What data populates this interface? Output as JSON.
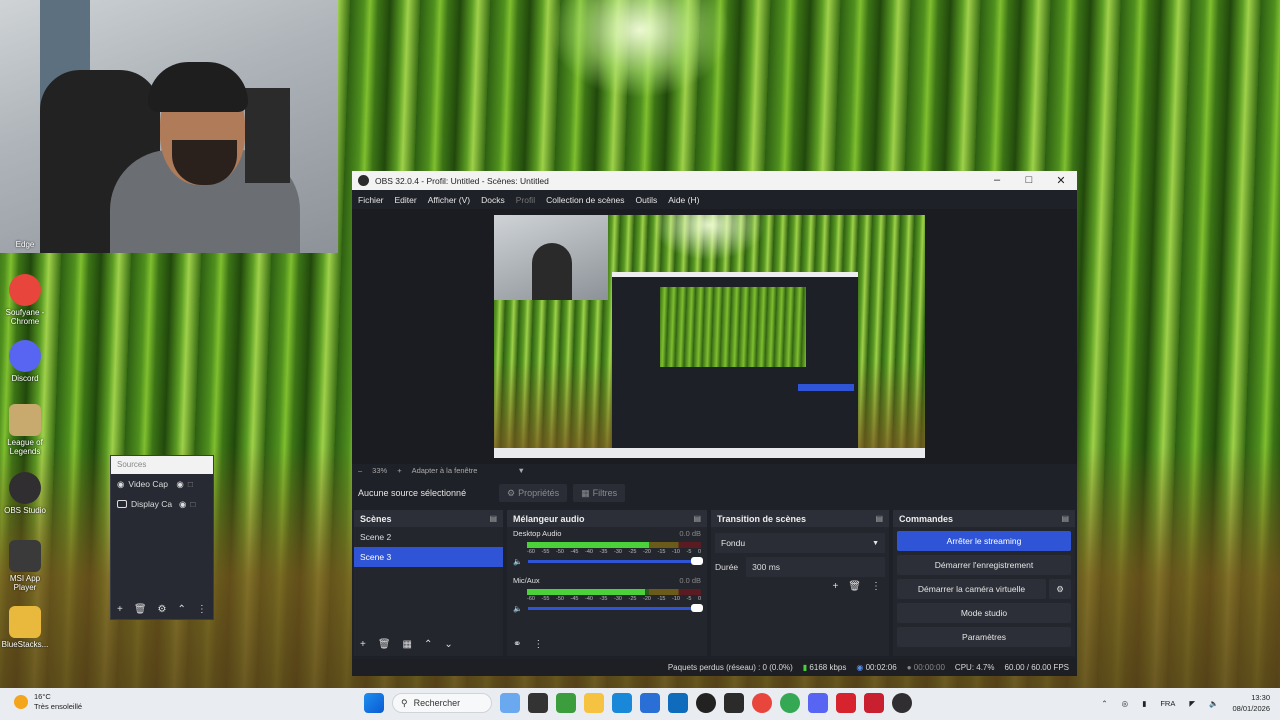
{
  "desktop": {
    "icons": [
      {
        "label": "Edge",
        "color": "#2a7bd6",
        "icon": "edge-icon"
      },
      {
        "label": "Soufyane - Chrome",
        "color": "#e8453c",
        "icon": "chrome-icon"
      },
      {
        "label": "Discord",
        "color": "#5865f2",
        "icon": "discord-icon"
      },
      {
        "label": "League of Legends",
        "color": "#c8aa6e",
        "icon": "league-icon"
      },
      {
        "label": "OBS Studio",
        "color": "#302e31",
        "icon": "obs-icon"
      },
      {
        "label": "MSI App Player",
        "color": "#3a3a3a",
        "icon": "msi-icon"
      },
      {
        "label": "BlueStacks...",
        "color": "#e8b93c",
        "icon": "folder-icon"
      }
    ]
  },
  "sources_dock": {
    "title": "Sources",
    "items": [
      "Video Cap",
      "Display Ca"
    ]
  },
  "obs": {
    "title": "OBS 32.0.4 - Profil: Untitled - Scènes: Untitled",
    "menu": [
      "Fichier",
      "Editer",
      "Afficher (V)",
      "Docks",
      "Profil",
      "Collection de scènes",
      "Outils",
      "Aide (H)"
    ],
    "zoom": "33%",
    "fit_label": "Adapter à la fenêtre",
    "no_source": "Aucune source sélectionné",
    "properties": "Propriétés",
    "filters": "Filtres",
    "scenes_title": "Scènes",
    "scenes": [
      "Scene 2",
      "Scene 3"
    ],
    "selected_scene": "Scene 3",
    "mixer_title": "Mélangeur audio",
    "channels": [
      {
        "name": "Desktop Audio",
        "db": "0.0 dB",
        "level": 0.7
      },
      {
        "name": "Mic/Aux",
        "db": "0.0 dB",
        "level": 0.68
      }
    ],
    "meter_ticks": [
      "-60",
      "-55",
      "-50",
      "-45",
      "-40",
      "-35",
      "-30",
      "-25",
      "-20",
      "-15",
      "-10",
      "-5",
      "0"
    ],
    "transition_title": "Transition de scènes",
    "transition": "Fondu",
    "duration_label": "Durée",
    "duration": "300 ms",
    "commands_title": "Commandes",
    "commands": {
      "stream": "Arrêter le streaming",
      "record": "Démarrer l'enregistrement",
      "virtualcam": "Démarrer la caméra virtuelle",
      "studio": "Mode studio",
      "settings": "Paramètres"
    },
    "status": {
      "dropped": "Paquets perdus (réseau) : 0 (0.0%)",
      "bitrate": "6168 kbps",
      "stream_time": "00:02:06",
      "rec_time": "00:00:00",
      "cpu": "CPU: 4.7%",
      "fps": "60.00 / 60.00 FPS"
    },
    "accent": "#2f55d6"
  },
  "taskbar": {
    "temp": "16°C",
    "weather": "Très ensoleillé",
    "search": "Rechercher",
    "lang": "FRA",
    "time": "13:30",
    "date": "08/01/2026"
  }
}
